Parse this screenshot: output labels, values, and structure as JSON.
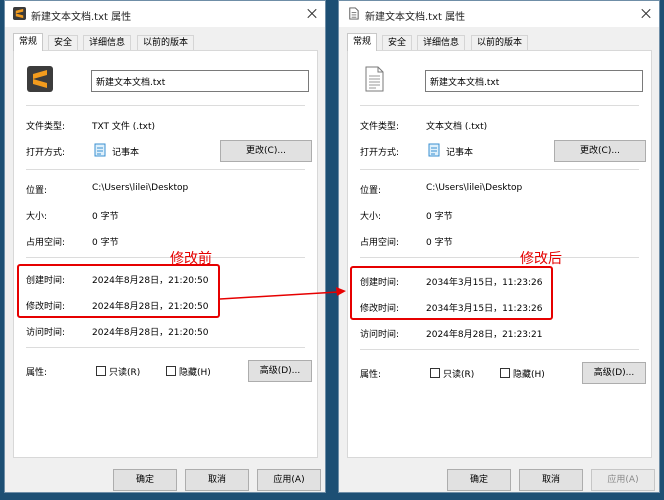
{
  "left": {
    "title": "新建文本文档.txt 属性",
    "tabs": [
      "常规",
      "安全",
      "详细信息",
      "以前的版本"
    ],
    "file_name": "新建文本文档.txt",
    "type_label": "文件类型:",
    "type_value": "TXT 文件 (.txt)",
    "open_label": "打开方式:",
    "open_value": "记事本",
    "change_btn": "更改(C)...",
    "location_label": "位置:",
    "location_value": "C:\\Users\\lilei\\Desktop",
    "size_label": "大小:",
    "size_value": "0 字节",
    "disk_label": "占用空间:",
    "disk_value": "0 字节",
    "created_label": "创建时间:",
    "created_value": "2024年8月28日，21:20:50",
    "modified_label": "修改时间:",
    "modified_value": "2024年8月28日，21:20:50",
    "accessed_label": "访问时间:",
    "accessed_value": "2024年8月28日，21:20:50",
    "attr_label": "属性:",
    "readonly_label": "只读(R)",
    "hidden_label": "隐藏(H)",
    "advanced_btn": "高级(D)...",
    "ok_btn": "确定",
    "cancel_btn": "取消",
    "apply_btn": "应用(A)",
    "annotation": "修改前"
  },
  "right": {
    "title": "新建文本文档.txt 属性",
    "tabs": [
      "常规",
      "安全",
      "详细信息",
      "以前的版本"
    ],
    "file_name": "新建文本文档.txt",
    "type_label": "文件类型:",
    "type_value": "文本文档 (.txt)",
    "open_label": "打开方式:",
    "open_value": "记事本",
    "change_btn": "更改(C)...",
    "location_label": "位置:",
    "location_value": "C:\\Users\\lilei\\Desktop",
    "size_label": "大小:",
    "size_value": "0 字节",
    "disk_label": "占用空间:",
    "disk_value": "0 字节",
    "created_label": "创建时间:",
    "created_value": "2034年3月15日，11:23:26",
    "modified_label": "修改时间:",
    "modified_value": "2034年3月15日，11:23:26",
    "accessed_label": "访问时间:",
    "accessed_value": "2024年8月28日，21:23:21",
    "attr_label": "属性:",
    "readonly_label": "只读(R)",
    "hidden_label": "隐藏(H)",
    "advanced_btn": "高级(D)...",
    "ok_btn": "确定",
    "cancel_btn": "取消",
    "apply_btn": "应用(A)",
    "annotation": "修改后"
  },
  "colors": {
    "annotation_red": "#e60000",
    "sublime_orange": "#f29b1d",
    "desktop_bg": "#1d4f74"
  },
  "icons": {
    "left_file_icon": "sublime-text-icon",
    "right_file_icon": "text-document-icon",
    "open_with_icon": "notepad-icon"
  }
}
